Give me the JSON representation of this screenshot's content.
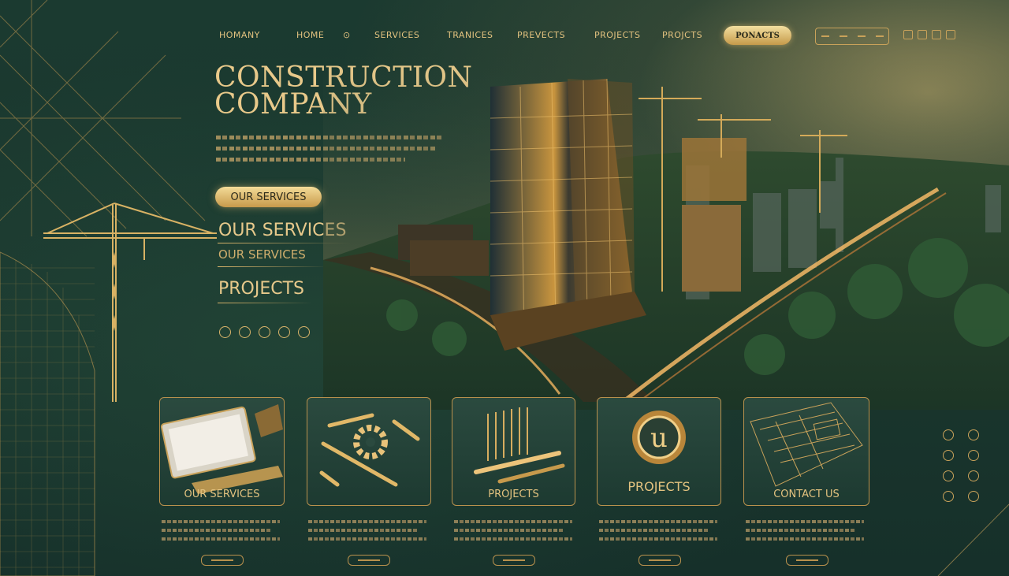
{
  "nav": {
    "items": [
      "HOMANY",
      "HOME",
      "SERVICES",
      "TRANICES",
      "PREVECTS",
      "PROJECTS",
      "PROJCTS"
    ],
    "extra_glyph": "⊙",
    "cta": "PONACTS"
  },
  "hero": {
    "title_line1": "CONSTRUCTION",
    "title_line2": "COMPANY",
    "button": "OUR SERVICES",
    "services_heading": "OUR SERVICES",
    "services_subheading": "OUR SERVICES",
    "projects_heading": "PROJECTS"
  },
  "cards": [
    {
      "label": "OUR SERVICES",
      "icon": "laptop-icon"
    },
    {
      "label": "",
      "icon": "tools-icon"
    },
    {
      "label": "PROJECTS",
      "icon": "blueprint-roll-icon"
    },
    {
      "label": "PROJECTS",
      "icon": "logo-icon",
      "glyph": "u"
    },
    {
      "label": "CONTACT US",
      "icon": "blueprint-icon"
    }
  ],
  "colors": {
    "gold": "#d9b46a",
    "background": "#163129",
    "accent_bright": "#f3dfa0"
  }
}
